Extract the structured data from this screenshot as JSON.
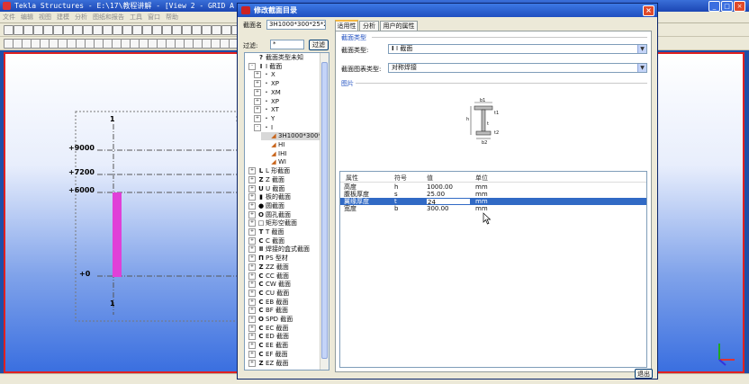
{
  "main_window": {
    "title": "Tekla Structures - E:\\17\\教程讲解 - [View 2 - GRID A",
    "menus": [
      "文件",
      "编辑",
      "视图",
      "建模",
      "分析",
      "图纸和报告",
      "工具",
      "窗口",
      "帮助"
    ]
  },
  "view": {
    "grid_columns": [
      "1",
      "2",
      "1"
    ],
    "levels": [
      "+9000",
      "+7200",
      "+6000",
      "+0"
    ],
    "column_color": "#e040d8"
  },
  "dialog": {
    "title": "修改截面目录",
    "profile_name_label": "截面名",
    "profile_name_value": "3H1000*300*25*24",
    "filter_label": "过滤:",
    "filter_value": "*",
    "filter_button": "过滤",
    "tabs": [
      "适用性",
      "分析",
      "用户的属性"
    ],
    "tree": [
      {
        "icon": "?",
        "label": "截面类型未知",
        "expander": ""
      },
      {
        "icon": "I",
        "label": "I 截面",
        "expander": "-"
      },
      {
        "icon": "·",
        "label": "X",
        "expander": "+"
      },
      {
        "icon": "·",
        "label": "XP",
        "expander": "+"
      },
      {
        "icon": "·",
        "label": "XM",
        "expander": "+"
      },
      {
        "icon": "·",
        "label": "XP",
        "expander": "+"
      },
      {
        "icon": "·",
        "label": "XT",
        "expander": "+"
      },
      {
        "icon": "·",
        "label": "Y",
        "expander": "+"
      },
      {
        "icon": "·",
        "label": "I",
        "expander": "-"
      },
      {
        "icon": "◢",
        "label": "3H1000*300*25",
        "expander": ""
      },
      {
        "icon": "◢",
        "label": "HI",
        "expander": ""
      },
      {
        "icon": "◢",
        "label": "IHI",
        "expander": ""
      },
      {
        "icon": "◢",
        "label": "WI",
        "expander": ""
      },
      {
        "icon": "L",
        "label": "L 形截面",
        "expander": "+"
      },
      {
        "icon": "Z",
        "label": "Z 截面",
        "expander": "+"
      },
      {
        "icon": "U",
        "label": "U 截面",
        "expander": "+"
      },
      {
        "icon": "▮",
        "label": "板的截面",
        "expander": "+"
      },
      {
        "icon": "●",
        "label": "圆截面",
        "expander": "+"
      },
      {
        "icon": "O",
        "label": "圆孔截面",
        "expander": "+"
      },
      {
        "icon": "□",
        "label": "矩形空截面",
        "expander": "+"
      },
      {
        "icon": "T",
        "label": "T 截面",
        "expander": "+"
      },
      {
        "icon": "C",
        "label": "C 截面",
        "expander": "+"
      },
      {
        "icon": "Ⅱ",
        "label": "焊接的盒式截面",
        "expander": "+"
      },
      {
        "icon": "Π",
        "label": "PS 型材",
        "expander": "+"
      },
      {
        "icon": "Z",
        "label": "ZZ 截面",
        "expander": "+"
      },
      {
        "icon": "C",
        "label": "CC 截面",
        "expander": "+"
      },
      {
        "icon": "C",
        "label": "CW 截面",
        "expander": "+"
      },
      {
        "icon": "C",
        "label": "CU 截面",
        "expander": "+"
      },
      {
        "icon": "C",
        "label": "EB 截面",
        "expander": "+"
      },
      {
        "icon": "C",
        "label": "BF 截面",
        "expander": "+"
      },
      {
        "icon": "O",
        "label": "SPD 截面",
        "expander": "+"
      },
      {
        "icon": "C",
        "label": "EC 截面",
        "expander": "+"
      },
      {
        "icon": "C",
        "label": "ED 截面",
        "expander": "+"
      },
      {
        "icon": "C",
        "label": "EE 截面",
        "expander": "+"
      },
      {
        "icon": "C",
        "label": "EF 截面",
        "expander": "+"
      },
      {
        "icon": "Z",
        "label": "EZ 截面",
        "expander": "+"
      }
    ],
    "section_type_header": "截面类型",
    "profile_type_label": "截面类型:",
    "profile_type_value": "I 截面",
    "sub_type_label": "截面图表类型:",
    "sub_type_value": "对称焊接",
    "picture_header": "图片",
    "diagram_labels": {
      "b1": "b1",
      "h": "h",
      "t1": "t1",
      "t": "t",
      "t2": "t2",
      "b2": "b2"
    },
    "properties": {
      "headers": [
        "属性",
        "符号",
        "值",
        "单位"
      ],
      "rows": [
        {
          "name": "高度",
          "symbol": "h",
          "value": "1000.00",
          "unit": "mm"
        },
        {
          "name": "腹板厚度",
          "symbol": "s",
          "value": "25.00",
          "unit": "mm"
        },
        {
          "name": "翼缘厚度",
          "symbol": "t",
          "value": "24",
          "unit": "mm"
        },
        {
          "name": "宽度",
          "symbol": "b",
          "value": "300.00",
          "unit": "mm"
        }
      ],
      "selected_row": 2
    },
    "cancel_button": "退出"
  }
}
